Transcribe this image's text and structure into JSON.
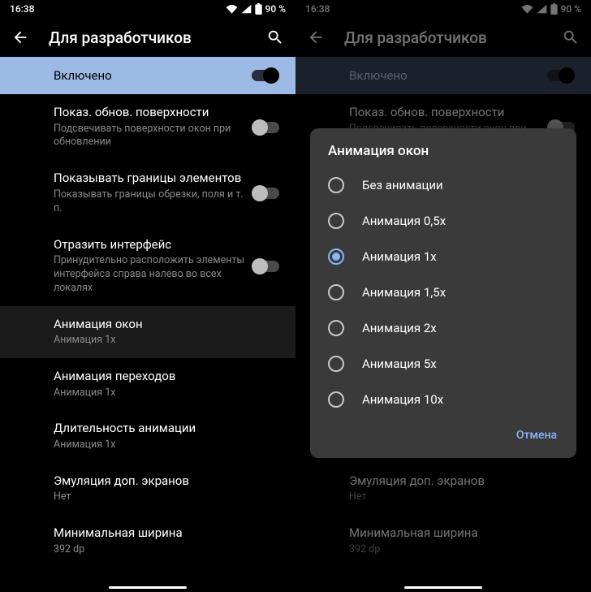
{
  "status": {
    "time": "16:38",
    "battery": "90 %"
  },
  "header": {
    "title": "Для разработчиков"
  },
  "enabled": {
    "label": "Включено"
  },
  "items": [
    {
      "title": "Показ. обнов. поверхности",
      "sub": "Подсвечивать поверхности окон при обновлении",
      "toggle": true,
      "on": false
    },
    {
      "title": "Показывать границы элементов",
      "sub": "Показывать границы обрезки, поля и т. п.",
      "toggle": true,
      "on": false
    },
    {
      "title": "Отразить интерфейс",
      "sub": "Принудительно расположить элементы интерфейса справа налево во всех локалях",
      "toggle": true,
      "on": false
    },
    {
      "title": "Анимация окон",
      "sub": "Анимация 1x",
      "toggle": false,
      "highlight": true
    },
    {
      "title": "Анимация переходов",
      "sub": "Анимация 1x",
      "toggle": false
    },
    {
      "title": "Длительность анимации",
      "sub": "Анимация 1x",
      "toggle": false
    },
    {
      "title": "Эмуляция доп. экранов",
      "sub": "Нет",
      "toggle": false
    },
    {
      "title": "Минимальная ширина",
      "sub": "392 dp",
      "toggle": false
    }
  ],
  "dialog": {
    "title": "Анимация окон",
    "options": [
      "Без анимации",
      "Анимация 0,5x",
      "Анимация 1x",
      "Анимация 1,5x",
      "Анимация 2x",
      "Анимация 5x",
      "Анимация 10x"
    ],
    "selected": 2,
    "cancel": "Отмена"
  }
}
